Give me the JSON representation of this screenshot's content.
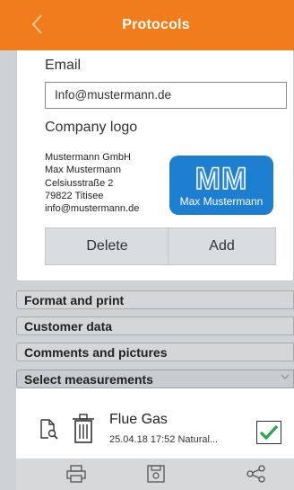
{
  "header": {
    "title": "Protocols"
  },
  "email": {
    "label": "Email",
    "value": "Info@mustermann.de"
  },
  "company_logo": {
    "label": "Company logo",
    "address_lines": [
      "Mustermann GmbH",
      "Max Mustermann",
      "Celsiusstraße 2",
      "79822 Titisee",
      "info@mustermann.de"
    ],
    "logo_text": "MM",
    "logo_name": "Max Mustermann",
    "logo_color": "#1e7fd0"
  },
  "buttons": {
    "delete_label": "Delete",
    "add_label": "Add"
  },
  "sections": [
    {
      "label": "Format and print"
    },
    {
      "label": "Customer data"
    },
    {
      "label": "Comments and pictures"
    },
    {
      "label": "Select measurements"
    }
  ],
  "measurement": {
    "title": "Flue Gas",
    "subtitle": "25.04.18 17:52 Natural...",
    "checked": true
  },
  "colors": {
    "accent": "#f07c1c",
    "check": "#2aa34a"
  },
  "footer": {
    "icons": [
      "print-icon",
      "save-icon",
      "share-icon"
    ]
  }
}
